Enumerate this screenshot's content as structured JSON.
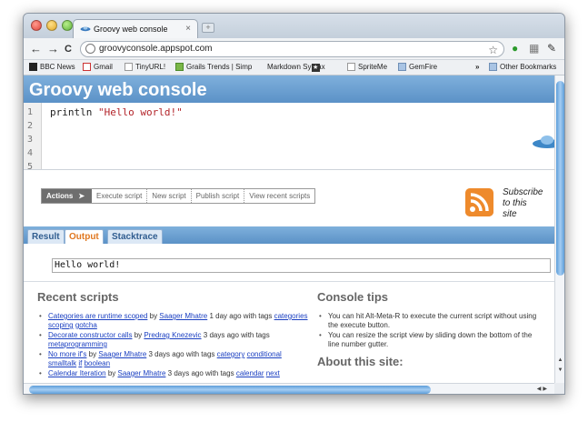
{
  "browser": {
    "tab_title": "Groovy web console",
    "tab_close": "×",
    "new_tab": "+",
    "url": "groovyconsole.appspot.com",
    "back": "←",
    "forward": "→",
    "reload": "C",
    "bookmark_star": "☆",
    "bookmarks_overflow": "»",
    "bookmarks": [
      {
        "label": "BBC News",
        "icon": "bbc-icon"
      },
      {
        "label": "Gmail",
        "icon": "gmail-icon"
      },
      {
        "label": "TinyURL!",
        "icon": "page-icon"
      },
      {
        "label": "Grails Trends | Simp",
        "icon": "grails-icon"
      },
      {
        "label": "Markdown Syntax",
        "icon": "star-icon"
      },
      {
        "label": "SpriteMe",
        "icon": "page-icon"
      },
      {
        "label": "GemFire",
        "icon": "folder-icon"
      },
      {
        "label": "Other Bookmarks",
        "icon": "folder-icon"
      }
    ]
  },
  "page": {
    "title": "Groovy web console",
    "line_numbers": [
      "1",
      "2",
      "3",
      "4",
      "5"
    ],
    "code_prefix": "println ",
    "code_string": "\"Hello world!\"",
    "actions": {
      "label": "Actions",
      "arrow": "➤",
      "buttons": [
        "Execute script",
        "New script",
        "Publish script",
        "View recent scripts"
      ]
    },
    "subscribe": [
      "Subscribe",
      "to this",
      "site"
    ],
    "result_tabs": [
      "Result",
      "Output",
      "Stacktrace"
    ],
    "active_tab": "Output",
    "output_text": "Hello world!",
    "recent_scripts_title": "Recent scripts",
    "recent_scripts": [
      {
        "title": "Categories are runtime scoped",
        "by": " by ",
        "author": "Saager Mhatre",
        "time": " 1 day ago with tags ",
        "tags": [
          "categories",
          "scoping",
          "gotcha"
        ]
      },
      {
        "title": "Decorate constructor calls",
        "by": " by ",
        "author": "Predrag Knezevic",
        "time": " 3 days ago with tags ",
        "tags": [
          "metaprogramming"
        ]
      },
      {
        "title": "No more if's",
        "by": " by ",
        "author": "Saager Mhatre",
        "time": " 3 days ago with tags ",
        "tags": [
          "category",
          "conditional",
          "smalltalk",
          "if",
          "boolean"
        ]
      },
      {
        "title": "Calendar Iteration",
        "by": " by ",
        "author": "Saager Mhatre",
        "time": " 3 days ago with tags ",
        "tags": [
          "calendar",
          "next"
        ]
      }
    ],
    "console_tips_title": "Console tips",
    "console_tips": [
      "You can hit Alt-Meta-R to execute the current script without using the execute button.",
      "You can resize the script view by sliding down the bottom of the line number gutter."
    ],
    "about_title": "About this site:"
  },
  "colors": {
    "header_blue": "#5b92c7",
    "active_tab_orange": "#e07820",
    "link_blue": "#1a3fc1",
    "string_red": "#b3242a"
  }
}
